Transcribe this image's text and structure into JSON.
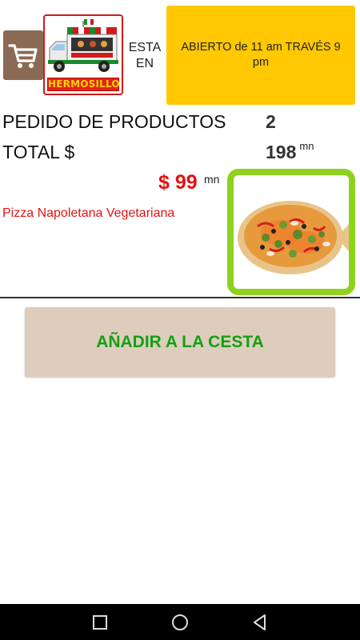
{
  "header": {
    "cart_icon": "shopping-cart-icon",
    "logo_text": "HERMOSILLO",
    "status_label": "ESTA EN",
    "hours_text": "ABIERTO de 11 am TRAVÉS 9 pm"
  },
  "summary": {
    "order_label": "PEDIDO DE PRODUCTOS",
    "order_count": "2",
    "total_label": "TOTAL $",
    "total_value": "198",
    "total_unit": "mn"
  },
  "product": {
    "price": "$ 99",
    "price_unit": "mn",
    "name": "Pizza Napoletana Vegetariana"
  },
  "actions": {
    "add_to_cart_label": "AÑADIR A LA CESTA"
  },
  "navbar": {
    "icons": [
      "recent-apps-icon",
      "home-icon",
      "back-icon"
    ]
  },
  "colors": {
    "hours_bg": "#ffc800",
    "price": "#e21212",
    "photo_frame": "#8ed21e",
    "add_button_bg": "#decdbd",
    "add_button_text": "#13a013",
    "cart_bg": "#8a6a55"
  }
}
